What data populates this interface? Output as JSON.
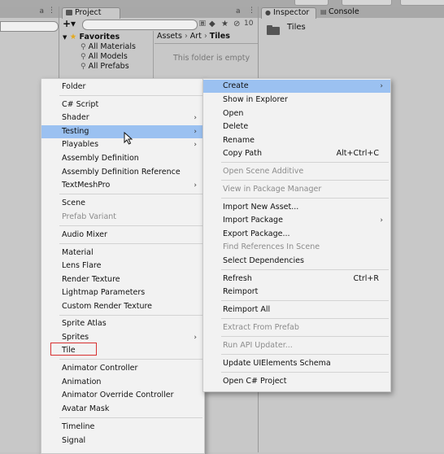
{
  "top": {
    "btn_a": "",
    "btn_b": ""
  },
  "project_panel": {
    "tab_label": "Project",
    "badge_count": "10",
    "favorites": {
      "header": "Favorites",
      "items": [
        "All Materials",
        "All Models",
        "All Prefabs"
      ]
    },
    "breadcrumb": [
      "Assets",
      "Art",
      "Tiles"
    ],
    "empty_message": "This folder is empty"
  },
  "inspector_panel": {
    "tab_inspector": "Inspector",
    "tab_console": "Console",
    "asset_name": "Tiles"
  },
  "create_menu": {
    "items": [
      {
        "label": "Folder"
      },
      {
        "label": "C# Script"
      },
      {
        "label": "Shader",
        "submenu": true
      },
      {
        "label": "Testing",
        "submenu": true,
        "highlighted": true
      },
      {
        "label": "Playables",
        "submenu": true
      },
      {
        "label": "Assembly Definition"
      },
      {
        "label": "Assembly Definition Reference"
      },
      {
        "label": "TextMeshPro",
        "submenu": true
      },
      {
        "label": "Scene"
      },
      {
        "label": "Prefab Variant",
        "disabled": true
      },
      {
        "label": "Audio Mixer"
      },
      {
        "label": "Material"
      },
      {
        "label": "Lens Flare"
      },
      {
        "label": "Render Texture"
      },
      {
        "label": "Lightmap Parameters"
      },
      {
        "label": "Custom Render Texture"
      },
      {
        "label": "Sprite Atlas"
      },
      {
        "label": "Sprites",
        "submenu": true
      },
      {
        "label": "Tile"
      },
      {
        "label": "Animator Controller"
      },
      {
        "label": "Animation"
      },
      {
        "label": "Animator Override Controller"
      },
      {
        "label": "Avatar Mask"
      },
      {
        "label": "Timeline"
      },
      {
        "label": "Signal"
      }
    ]
  },
  "context_menu": {
    "items": [
      {
        "label": "Create",
        "submenu": true,
        "highlighted": true
      },
      {
        "label": "Show in Explorer"
      },
      {
        "label": "Open"
      },
      {
        "label": "Delete"
      },
      {
        "label": "Rename"
      },
      {
        "label": "Copy Path",
        "shortcut": "Alt+Ctrl+C"
      },
      {
        "label": "Open Scene Additive",
        "disabled": true
      },
      {
        "label": "View in Package Manager",
        "disabled": true
      },
      {
        "label": "Import New Asset..."
      },
      {
        "label": "Import Package",
        "submenu": true
      },
      {
        "label": "Export Package..."
      },
      {
        "label": "Find References In Scene",
        "disabled": true
      },
      {
        "label": "Select Dependencies"
      },
      {
        "label": "Refresh",
        "shortcut": "Ctrl+R"
      },
      {
        "label": "Reimport"
      },
      {
        "label": "Reimport All"
      },
      {
        "label": "Extract From Prefab",
        "disabled": true
      },
      {
        "label": "Run API Updater...",
        "disabled": true
      },
      {
        "label": "Update UIElements Schema"
      },
      {
        "label": "Open C# Project"
      }
    ]
  },
  "colors": {
    "highlight": "#9bc1f1",
    "annotation_box": "#d83030",
    "disabled_text": "#8c8c8c"
  }
}
